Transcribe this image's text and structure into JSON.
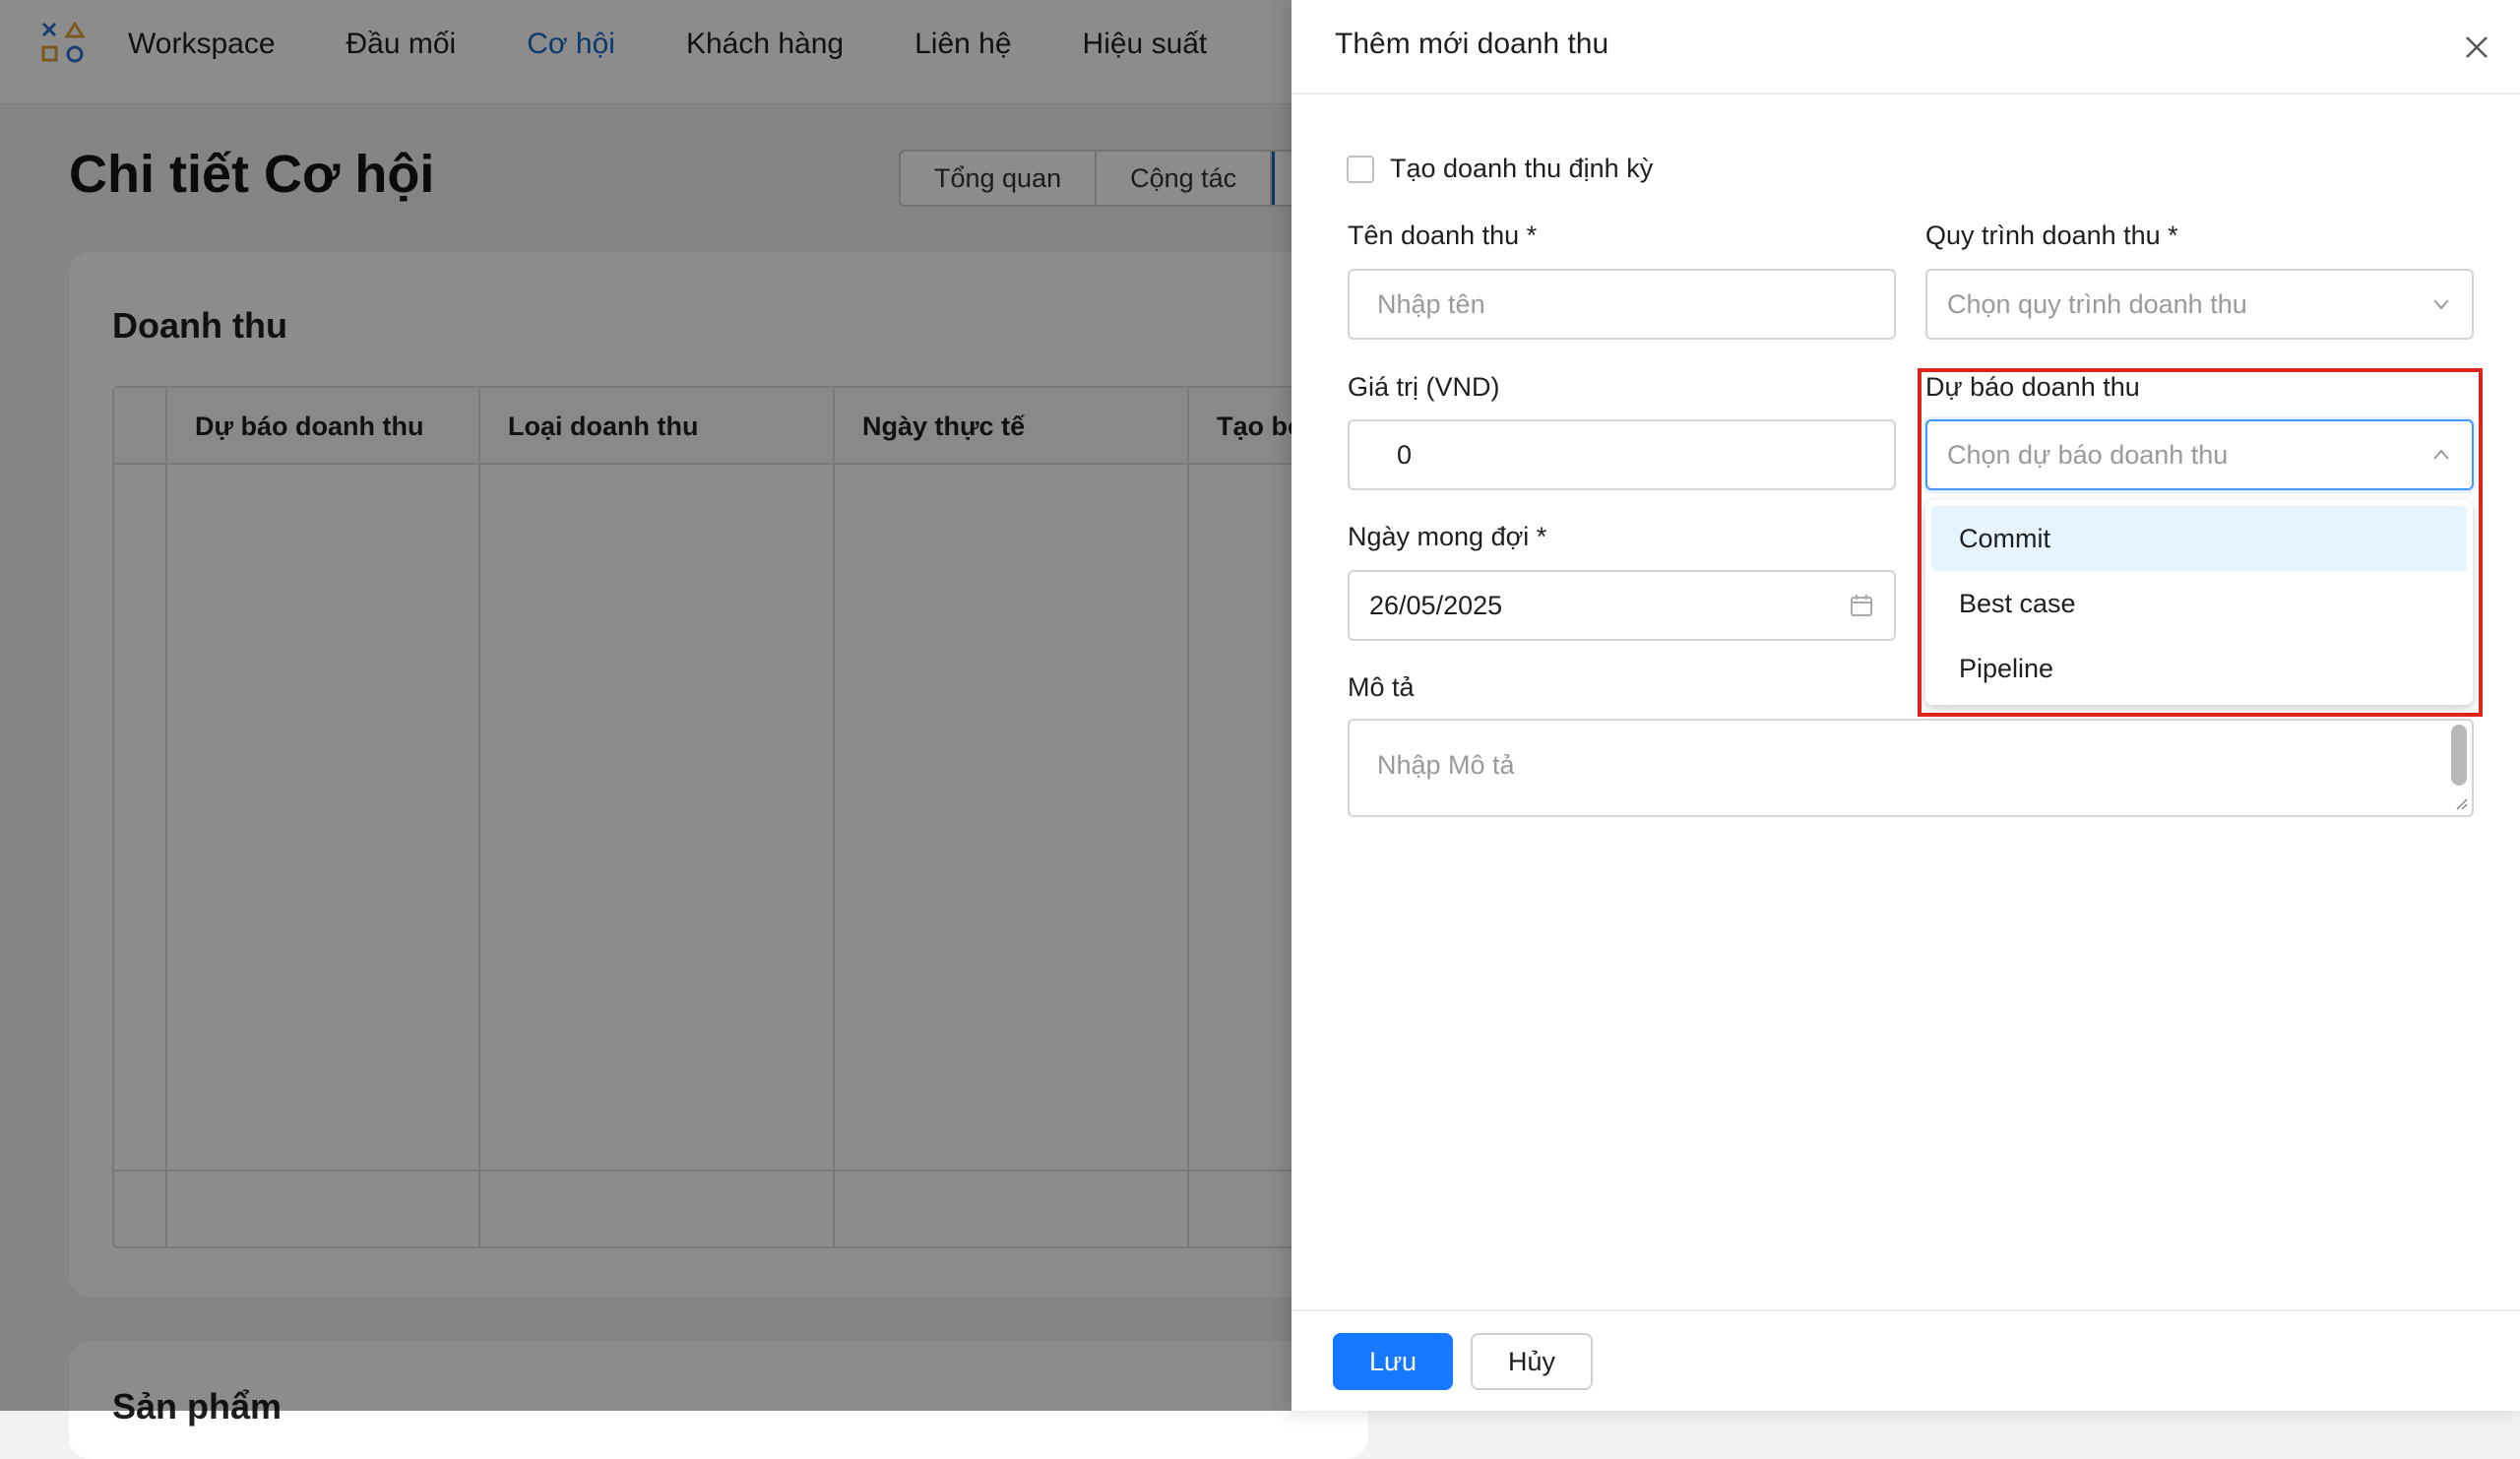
{
  "topnav": {
    "items": [
      "Workspace",
      "Đầu mối",
      "Cơ hội",
      "Khách hàng",
      "Liên hệ",
      "Hiệu suất"
    ]
  },
  "page": {
    "title": "Chi tiết Cơ hội",
    "tabs": [
      "Tổng quan",
      "Cộng tác"
    ]
  },
  "revenue_card": {
    "title": "Doanh thu",
    "columns": [
      "Dự báo doanh thu",
      "Loại doanh thu",
      "Ngày thực tế",
      "Tạo bởi"
    ]
  },
  "products_card": {
    "title": "Sản phẩm"
  },
  "drawer": {
    "title": "Thêm mới doanh thu",
    "recurring_label": "Tạo doanh thu định kỳ",
    "name_label": "Tên doanh thu *",
    "name_placeholder": "Nhập tên",
    "process_label": "Quy trình doanh thu *",
    "process_placeholder": "Chọn quy trình doanh thu",
    "value_label": "Giá trị (VND)",
    "value": "0",
    "forecast_label": "Dự báo doanh thu",
    "forecast_placeholder": "Chọn dự báo doanh thu",
    "forecast_options": [
      "Commit",
      "Best case",
      "Pipeline"
    ],
    "date_label": "Ngày mong đợi *",
    "date_value": "26/05/2025",
    "desc_label": "Mô tả",
    "desc_placeholder": "Nhập Mô tả",
    "save_label": "Lưu",
    "cancel_label": "Hủy"
  },
  "colors": {
    "accent": "#1677ff",
    "nav_active": "#1769c4",
    "highlight": "#e0231b",
    "option_hover": "#e6f4ff"
  }
}
